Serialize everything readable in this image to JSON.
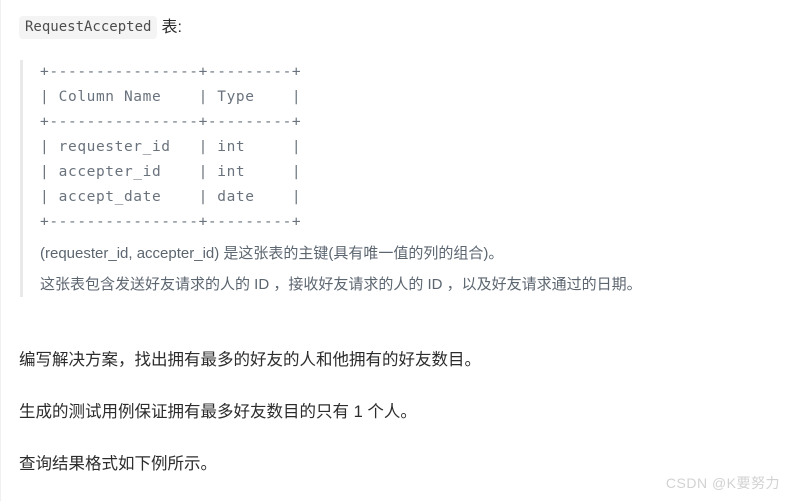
{
  "heading": {
    "code_badge": "RequestAccepted",
    "suffix": "表:"
  },
  "blockquote": {
    "ascii_table": "+----------------+---------+\n| Column Name    | Type    |\n+----------------+---------+\n| requester_id   | int     |\n| accepter_id    | int     |\n| accept_date    | date    |\n+----------------+---------+",
    "note_line_1": "(requester_id, accepter_id) 是这张表的主键(具有唯一值的列的组合)。",
    "note_line_2": "这张表包含发送好友请求的人的 ID ，接收好友请求的人的 ID ，以及好友请求通过的日期。"
  },
  "body": {
    "paragraphs": [
      "编写解决方案，找出拥有最多的好友的人和他拥有的好友数目。",
      "生成的测试用例保证拥有最多好友数目的只有 1 个人。",
      "查询结果格式如下例所示。"
    ]
  },
  "watermark": {
    "text": "CSDN @K要努力"
  },
  "colors": {
    "page_background": "#ffffff",
    "body_text": "#2c2c2c",
    "blockquote_text": "#5c6670",
    "ascii_table_text": "#6a737d",
    "blockquote_border": "#e9e9e9",
    "code_badge_background": "#f4f4f4",
    "watermark_text": "#d2d2d2"
  }
}
